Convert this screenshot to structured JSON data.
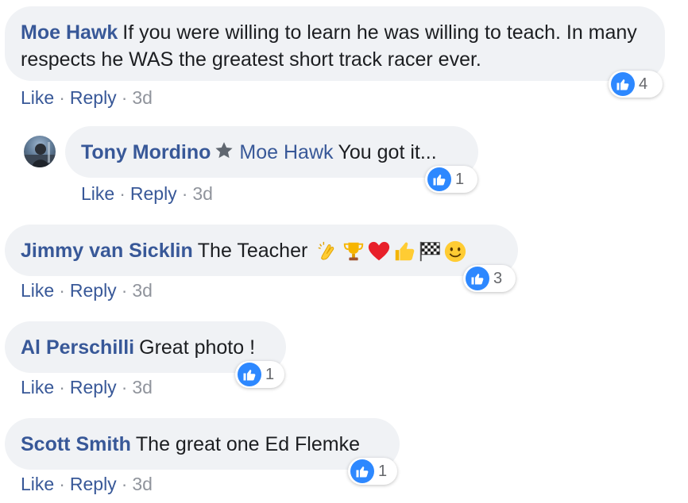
{
  "comments": [
    {
      "author": "Moe Hawk",
      "text": "If you were willing to learn he was willing to teach. In many respects he WAS the greatest short track racer ever.",
      "like_count": "4",
      "actions": {
        "like": "Like",
        "reply": "Reply",
        "sep": "·",
        "time": "3d"
      }
    },
    {
      "author": "Tony Mordino",
      "mention": "Moe Hawk",
      "text": "You got it...",
      "like_count": "1",
      "actions": {
        "like": "Like",
        "reply": "Reply",
        "sep": "·",
        "time": "3d"
      }
    },
    {
      "author": "Jimmy van Sicklin",
      "text": "The Teacher",
      "emojis": [
        "clapping-hands",
        "trophy",
        "red-heart",
        "thumbs-up",
        "checkered-flag",
        "smiling-face"
      ],
      "like_count": "3",
      "actions": {
        "like": "Like",
        "reply": "Reply",
        "sep": "·",
        "time": "3d"
      }
    },
    {
      "author": "Al Perschilli",
      "text": "Great photo !",
      "like_count": "1",
      "actions": {
        "like": "Like",
        "reply": "Reply",
        "sep": "·",
        "time": "3d"
      }
    },
    {
      "author": "Scott Smith",
      "text": "The great one Ed Flemke",
      "like_count": "1",
      "actions": {
        "like": "Like",
        "reply": "Reply",
        "sep": "·",
        "time": "3d"
      }
    }
  ],
  "colors": {
    "bubble": "#f0f2f5",
    "author": "#385898",
    "action": "#385898",
    "meta": "#90949c",
    "like_blue": "#2d88ff"
  }
}
